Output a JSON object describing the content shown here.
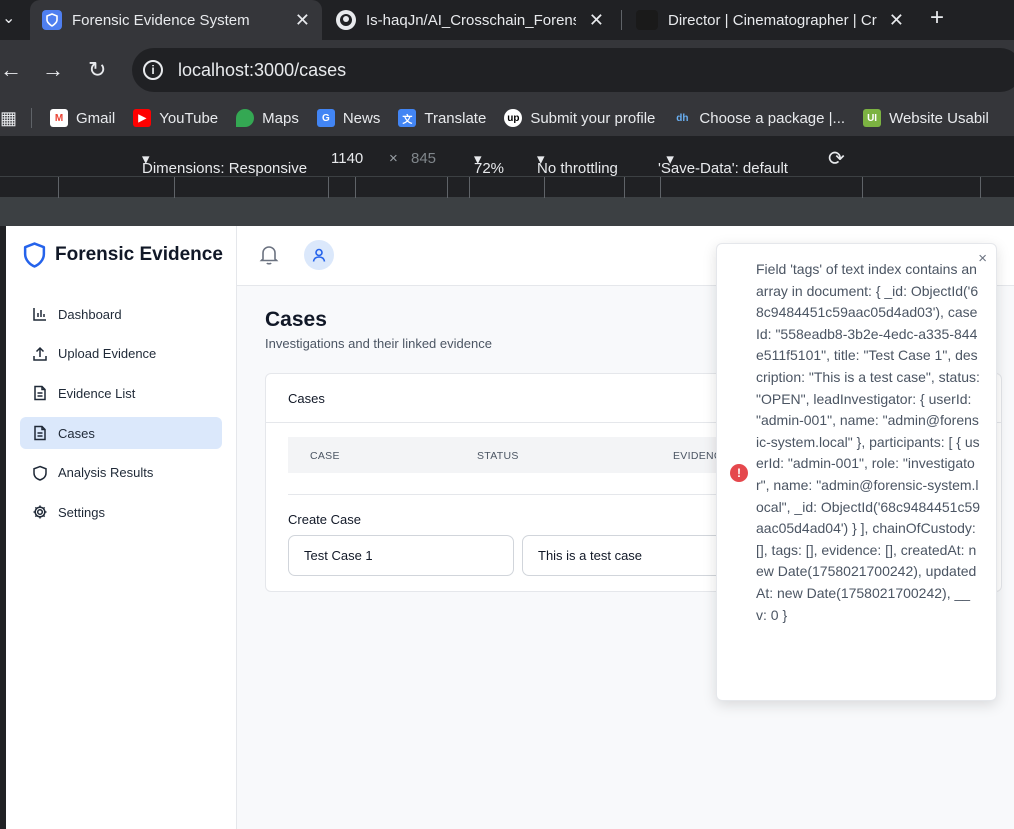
{
  "browser": {
    "tabs": [
      {
        "title": "Forensic Evidence System",
        "active": true
      },
      {
        "title": "Is-haqJn/AI_Crosschain_Forensic"
      },
      {
        "title": "Director | Cinematographer | Cr"
      }
    ],
    "url": "localhost:3000/cases",
    "bookmarks": [
      "Gmail",
      "YouTube",
      "Maps",
      "News",
      "Translate",
      "Submit your profile",
      "Choose a package |...",
      "Website Usabil"
    ],
    "devtools": {
      "dimensions": "Dimensions: Responsive",
      "width": "1140",
      "x": "×",
      "height": "845",
      "zoom": "72%",
      "throttling": "No throttling",
      "save_data": "'Save-Data': default"
    }
  },
  "app": {
    "brand": "Forensic Evidence",
    "nav": [
      {
        "label": "Dashboard",
        "icon": "bar-chart-icon"
      },
      {
        "label": "Upload Evidence",
        "icon": "upload-icon"
      },
      {
        "label": "Evidence List",
        "icon": "file-icon"
      },
      {
        "label": "Cases",
        "icon": "file-icon",
        "active": true
      },
      {
        "label": "Analysis Results",
        "icon": "shield-icon"
      },
      {
        "label": "Settings",
        "icon": "gear-icon"
      }
    ],
    "page_title": "Cases",
    "page_subtitle": "Investigations and their linked evidence",
    "card_title": "Cases",
    "table_headers": [
      "CASE",
      "STATUS",
      "EVIDENCE"
    ],
    "create_label": "Create Case",
    "inputs": {
      "title": "Test Case 1",
      "description": "This is a test case"
    }
  },
  "toast": {
    "message": "Field 'tags' of text index contains an array in document: { _id: ObjectId('68c9484451c59aac05d4ad03'), caseId: \"558eadb8-3b2e-4edc-a335-844e511f5101\", title: \"Test Case 1\", description: \"This is a test case\", status: \"OPEN\", leadInvestigator: { userId: \"admin-001\", name: \"admin@forensic-system.local\" }, participants: [ { userId: \"admin-001\", role: \"investigator\", name: \"admin@forensic-system.local\", _id: ObjectId('68c9484451c59aac05d4ad04') } ], chainOfCustody: [], tags: [], evidence: [], createdAt: new Date(1758021700242), updatedAt: new Date(1758021700242), __v: 0 }",
    "close": "×",
    "icon_glyph": "!"
  },
  "colors": {
    "accent": "#2563eb",
    "active_nav": "#dbe8fb",
    "error": "#e5484d"
  }
}
